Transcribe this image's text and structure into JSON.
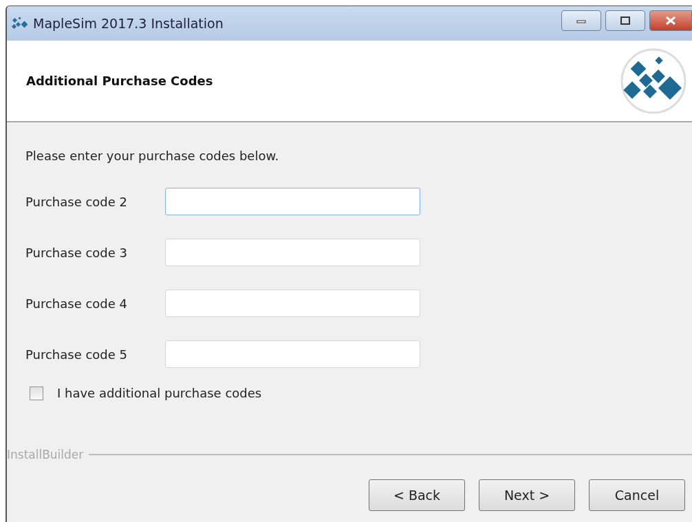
{
  "window": {
    "title": "MapleSim 2017.3 Installation"
  },
  "header": {
    "title": "Additional Purchase Codes"
  },
  "intro": "Please enter your purchase codes below.",
  "fields": [
    {
      "label": "Purchase code 2",
      "focused": true
    },
    {
      "label": "Purchase code 3",
      "focused": false
    },
    {
      "label": "Purchase code 4",
      "focused": false
    },
    {
      "label": "Purchase code 5",
      "focused": false
    }
  ],
  "checkbox": {
    "label": "I have additional purchase codes",
    "checked": false
  },
  "footer": {
    "brand": "InstallBuilder"
  },
  "buttons": [
    "< Back",
    "Next >",
    "Cancel"
  ]
}
